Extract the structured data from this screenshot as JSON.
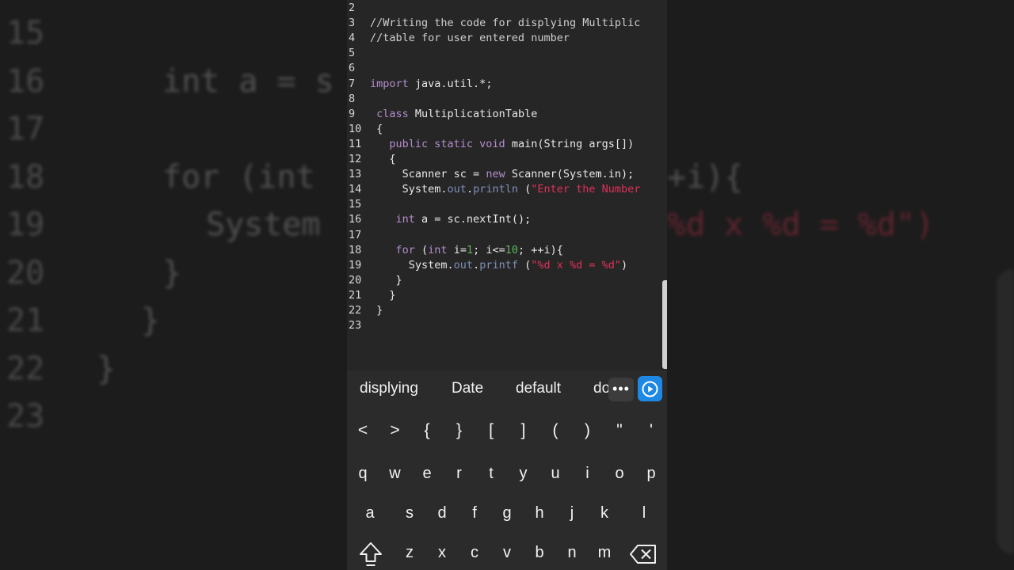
{
  "background_zoom": {
    "lines": [
      {
        "num": "15",
        "text": ""
      },
      {
        "num": "16",
        "text": "int a = s"
      },
      {
        "num": "17",
        "text": ""
      },
      {
        "num": "18",
        "text": "for (int"
      },
      {
        "num": "19",
        "text": "System"
      },
      {
        "num": "20",
        "text": "}"
      },
      {
        "num": "21",
        "text": "}"
      },
      {
        "num": "22",
        "text": "}"
      },
      {
        "num": "23",
        "text": ""
      }
    ],
    "right_fragment_18": "+i){",
    "right_fragment_19": "%d x %d = %d\")"
  },
  "editor": {
    "lines": [
      {
        "num": "2",
        "parts": []
      },
      {
        "num": "3",
        "parts": [
          {
            "t": "//Writing the code for displying Multiplic",
            "c": "cmt"
          }
        ]
      },
      {
        "num": "4",
        "parts": [
          {
            "t": "//table for user entered number",
            "c": "cmt"
          }
        ]
      },
      {
        "num": "5",
        "parts": []
      },
      {
        "num": "6",
        "parts": []
      },
      {
        "num": "7",
        "parts": [
          {
            "t": "import",
            "c": "kw"
          },
          {
            "t": " java.util.*;",
            "c": "id"
          }
        ]
      },
      {
        "num": "8",
        "parts": []
      },
      {
        "num": "9",
        "parts": [
          {
            "t": " class",
            "c": "kw"
          },
          {
            "t": " MultiplicationTable",
            "c": "id"
          }
        ]
      },
      {
        "num": "10",
        "parts": [
          {
            "t": " {",
            "c": "id"
          }
        ]
      },
      {
        "num": "11",
        "parts": [
          {
            "t": "   public static void",
            "c": "kw"
          },
          {
            "t": " main(String args[])",
            "c": "id"
          }
        ]
      },
      {
        "num": "12",
        "parts": [
          {
            "t": "   {",
            "c": "id"
          }
        ]
      },
      {
        "num": "13",
        "parts": [
          {
            "t": "     Scanner sc = ",
            "c": "id"
          },
          {
            "t": "new",
            "c": "kw"
          },
          {
            "t": " Scanner(System.in);",
            "c": "id"
          }
        ]
      },
      {
        "num": "14",
        "parts": [
          {
            "t": "     System.",
            "c": "id"
          },
          {
            "t": "out",
            "c": "fn"
          },
          {
            "t": ".",
            "c": "id"
          },
          {
            "t": "println",
            "c": "fn"
          },
          {
            "t": " (",
            "c": "id"
          },
          {
            "t": "\"Enter the Number",
            "c": "str"
          }
        ]
      },
      {
        "num": "15",
        "parts": []
      },
      {
        "num": "16",
        "parts": [
          {
            "t": "    int",
            "c": "kw"
          },
          {
            "t": " a = sc.nextInt();",
            "c": "id"
          }
        ]
      },
      {
        "num": "17",
        "parts": []
      },
      {
        "num": "18",
        "parts": [
          {
            "t": "    for",
            "c": "kw"
          },
          {
            "t": " (",
            "c": "id"
          },
          {
            "t": "int",
            "c": "kw"
          },
          {
            "t": " i=",
            "c": "id"
          },
          {
            "t": "1",
            "c": "num"
          },
          {
            "t": "; i<=",
            "c": "id"
          },
          {
            "t": "10",
            "c": "num"
          },
          {
            "t": "; ++i){",
            "c": "id"
          }
        ]
      },
      {
        "num": "19",
        "parts": [
          {
            "t": "      System.",
            "c": "id"
          },
          {
            "t": "out",
            "c": "fn"
          },
          {
            "t": ".",
            "c": "id"
          },
          {
            "t": "printf",
            "c": "fn"
          },
          {
            "t": " (",
            "c": "id"
          },
          {
            "t": "\"%d x %d = %d\"",
            "c": "str"
          },
          {
            "t": ")",
            "c": "id"
          }
        ]
      },
      {
        "num": "20",
        "parts": [
          {
            "t": "    }",
            "c": "id"
          }
        ]
      },
      {
        "num": "21",
        "parts": [
          {
            "t": "   }",
            "c": "id"
          }
        ]
      },
      {
        "num": "22",
        "parts": [
          {
            "t": " }",
            "c": "id"
          }
        ]
      },
      {
        "num": "23",
        "parts": []
      }
    ]
  },
  "keyboard": {
    "suggestions": [
      "displying",
      "Date",
      "default",
      "do"
    ],
    "more_label": "•••",
    "symbol_row": [
      "<",
      ">",
      "{",
      "}",
      "[",
      "]",
      "(",
      ")",
      "\"",
      "'"
    ],
    "row1": [
      "q",
      "w",
      "e",
      "r",
      "t",
      "y",
      "u",
      "i",
      "o",
      "p"
    ],
    "row2": [
      "a",
      "s",
      "d",
      "f",
      "g",
      "h",
      "j",
      "k",
      "l"
    ],
    "row3": [
      "z",
      "x",
      "c",
      "v",
      "b",
      "n",
      "m"
    ],
    "icons": {
      "shift": "shift-icon",
      "backspace": "backspace-icon",
      "go": "play-icon",
      "more": "more-dots-icon"
    },
    "accent_color": "#1e88e5"
  }
}
